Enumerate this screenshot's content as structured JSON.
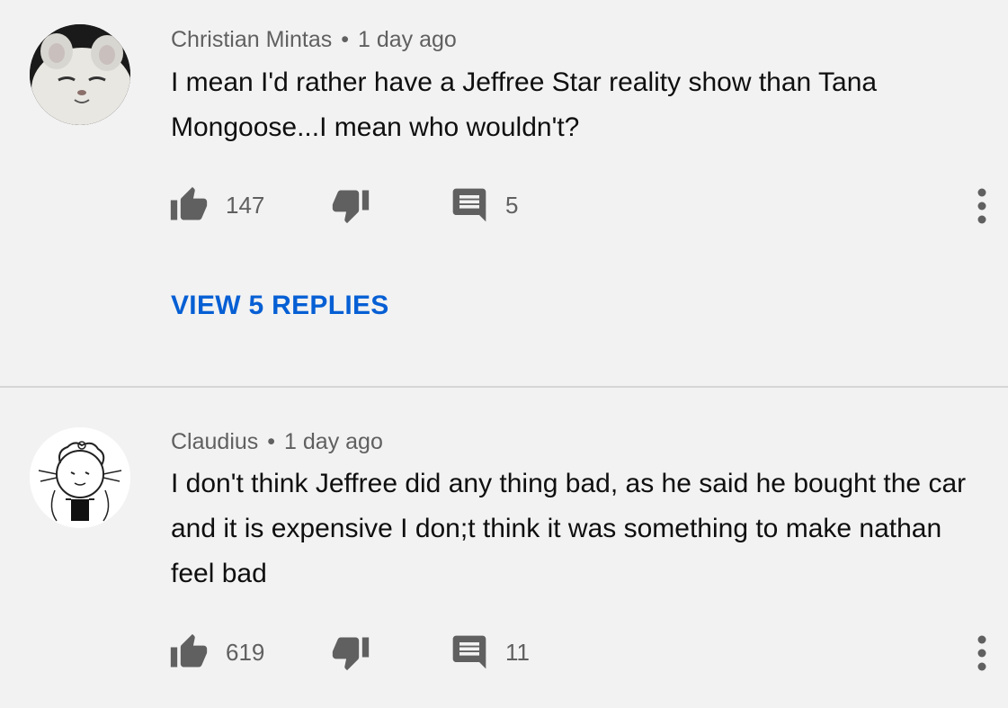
{
  "comments": [
    {
      "author": "Christian Mintas",
      "separator": "•",
      "time": "1 day ago",
      "text": "I mean I'd rather have a Jeffree Star reality show than Tana Mongoose...I mean who wouldn't?",
      "likes": "147",
      "replies": "5",
      "view_replies_label": "VIEW 5 REPLIES",
      "avatar": "cat-avatar"
    },
    {
      "author": "Claudius",
      "separator": "•",
      "time": "1 day ago",
      "text": "I don't think Jeffree did any thing bad, as  he said he bought the car and it is expensive I don;t think it was something to make nathan feel bad",
      "likes": "619",
      "replies": "11",
      "avatar": "drawing-avatar"
    }
  ],
  "icons": {
    "like": "thumbs-up-icon",
    "dislike": "thumbs-down-icon",
    "reply": "comment-icon",
    "more": "more-vertical-icon"
  },
  "colors": {
    "background": "#f2f2f2",
    "icon": "#606060",
    "link": "#065fd4",
    "text": "#0f0f0f",
    "meta": "#606060"
  }
}
